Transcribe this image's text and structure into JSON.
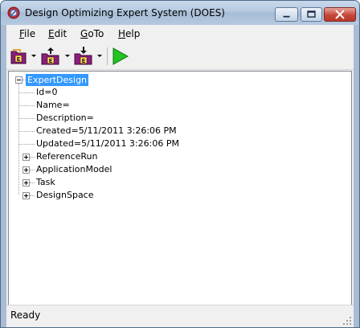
{
  "window": {
    "title": "Design Optimizing Expert System (DOES)"
  },
  "menu": {
    "items": [
      {
        "label": "File",
        "mnemonic": "F",
        "rest": "ile"
      },
      {
        "label": "Edit",
        "mnemonic": "E",
        "rest": "dit"
      },
      {
        "label": "GoTo",
        "mnemonic": "G",
        "rest": "oTo"
      },
      {
        "label": "Help",
        "mnemonic": "H",
        "rest": "elp"
      }
    ]
  },
  "toolbar": {
    "buttons": [
      {
        "icon": "open-design-icon",
        "letter": "E",
        "has_dropdown": true
      },
      {
        "icon": "upload-design-icon",
        "letter": "E",
        "has_dropdown": true
      },
      {
        "icon": "download-design-icon",
        "letter": "E",
        "has_dropdown": true
      },
      {
        "icon": "run-play-icon",
        "has_dropdown": false
      }
    ]
  },
  "tree": {
    "root": "ExpertDesign",
    "properties": [
      "Id=0",
      "Name=",
      "Description=",
      "Created=5/11/2011 3:26:06 PM",
      "Updated=5/11/2011 3:26:06 PM"
    ],
    "children": [
      "ReferenceRun",
      "ApplicationModel",
      "Task",
      "DesignSpace"
    ]
  },
  "status": {
    "text": "Ready"
  },
  "colors": {
    "selection": "#3399ff",
    "folder_purple": "#8a1f7a",
    "play_green": "#22c322"
  }
}
